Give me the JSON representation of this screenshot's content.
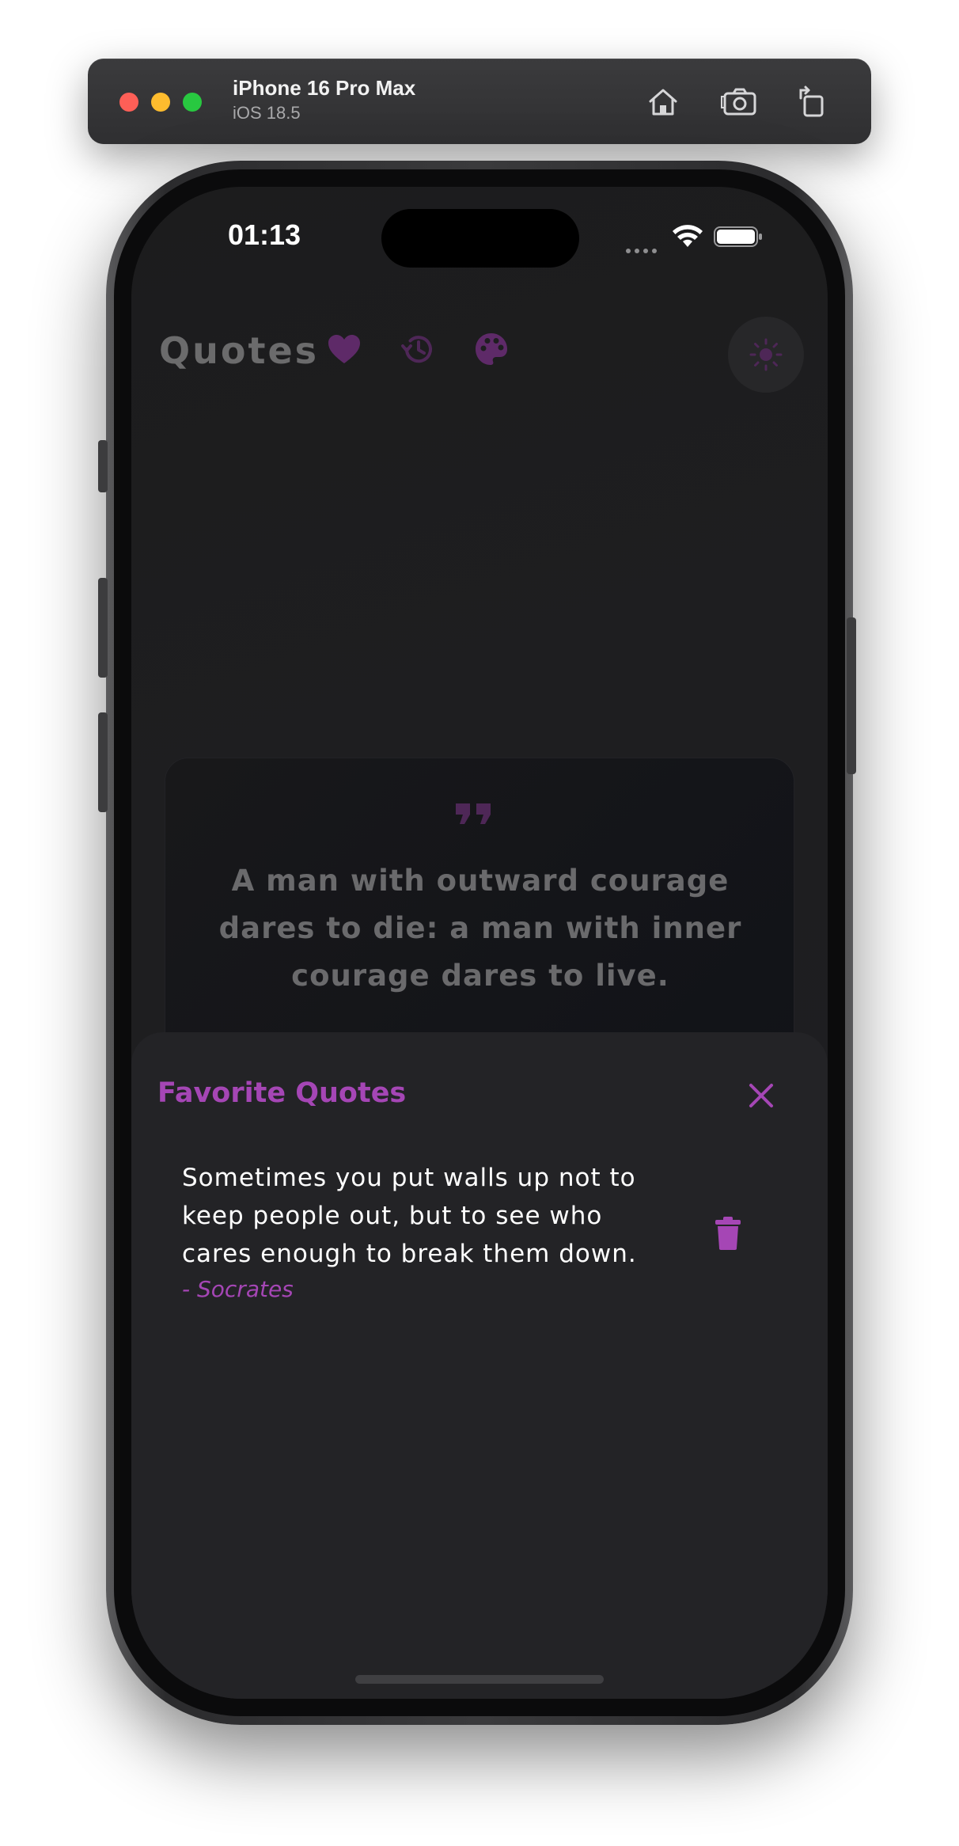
{
  "simulator": {
    "device_name": "iPhone 16 Pro Max",
    "os_version": "iOS 18.5",
    "toolbar_icons": [
      "home-icon",
      "screenshot-icon",
      "rotate-icon"
    ]
  },
  "status_bar": {
    "time": "01:13",
    "icons": [
      "cellular-signal-icon",
      "wifi-icon",
      "battery-icon"
    ]
  },
  "app": {
    "title": "Quotes",
    "header_icons": [
      "heart-icon",
      "history-icon",
      "palette-icon",
      "sun-icon"
    ],
    "accent_color": "#a546b5"
  },
  "quote_card": {
    "text": "A man with outward courage dares to die: a man with inner courage dares to live."
  },
  "favorites_sheet": {
    "title": "Favorite Quotes",
    "items": [
      {
        "text": "Sometimes you put walls up not to keep people out, but to see who cares enough to break them down.",
        "author": "- Socrates"
      }
    ]
  }
}
